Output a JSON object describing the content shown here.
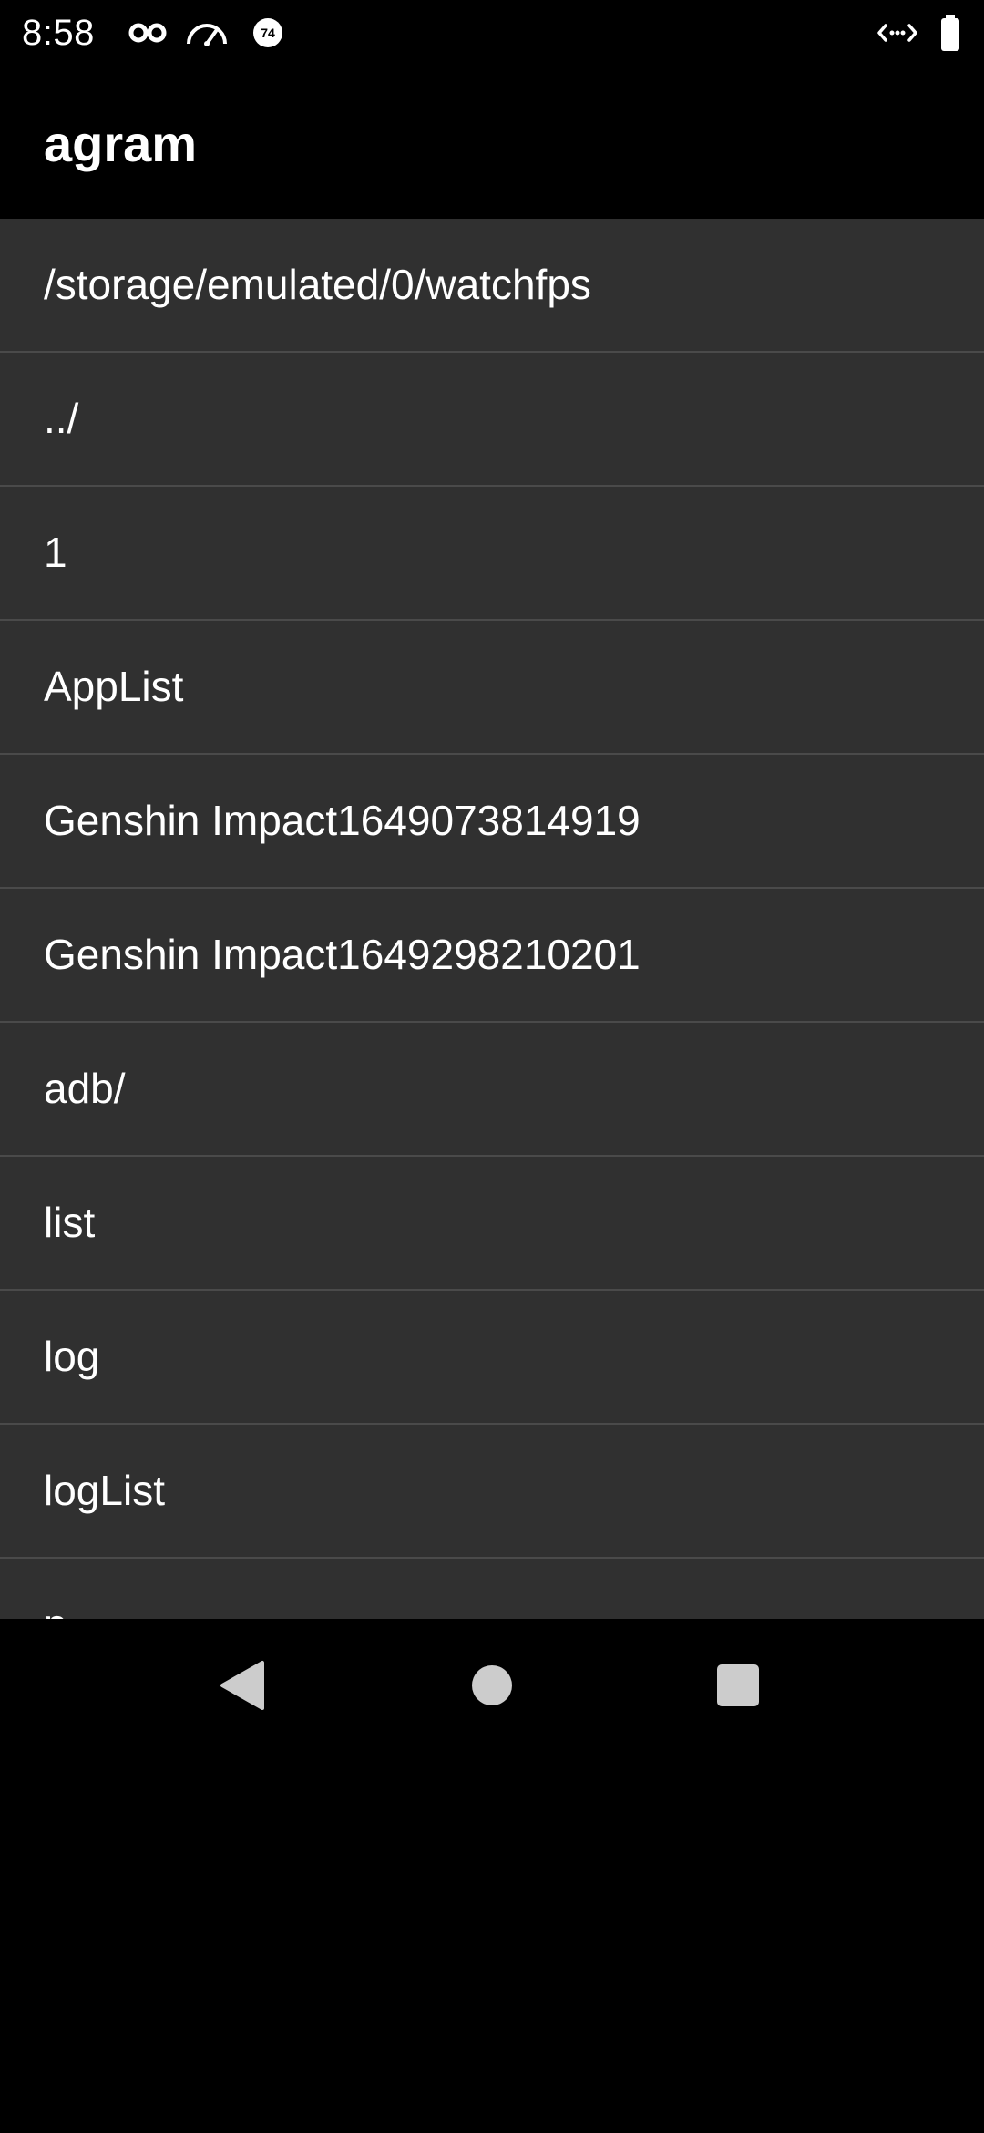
{
  "status_bar": {
    "time": "8:58",
    "icons": [
      "incognito-icon",
      "speedometer-icon",
      "notification-badge-icon",
      "data-transfer-icon",
      "battery-icon"
    ],
    "badge_number": "74"
  },
  "app_bar": {
    "title": "agram"
  },
  "file_list": {
    "items": [
      {
        "label": "/storage/emulated/0/watchfps"
      },
      {
        "label": "../"
      },
      {
        "label": "1"
      },
      {
        "label": "AppList"
      },
      {
        "label": "Genshin Impact1649073814919"
      },
      {
        "label": "Genshin Impact1649298210201"
      },
      {
        "label": "adb/"
      },
      {
        "label": "list"
      },
      {
        "label": "log"
      },
      {
        "label": "logList"
      },
      {
        "label": "p"
      }
    ]
  },
  "nav_bar": {
    "buttons": [
      "back-icon",
      "home-icon",
      "recents-icon"
    ]
  },
  "colors": {
    "background": "#000000",
    "list_background": "#303030",
    "divider": "#4a4a4a",
    "text": "#ffffff"
  }
}
